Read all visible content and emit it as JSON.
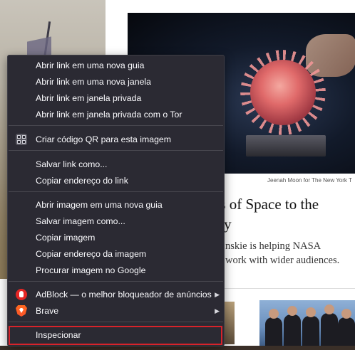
{
  "page": {
    "caption": "Jeenah Moon for The New York T",
    "headline_line1": "ths of Space to the",
    "headline_line2": "lery",
    "summary_line1": "nskie is helping NASA",
    "summary_line2": "work with wider audiences."
  },
  "context_menu": {
    "items": [
      {
        "label": "Abrir link em uma nova guia"
      },
      {
        "label": "Abrir link em uma nova janela"
      },
      {
        "label": "Abrir link em janela privada"
      },
      {
        "label": "Abrir link em janela privada com o Tor"
      },
      {
        "label": "Criar código QR para esta imagem",
        "icon": "qr-code-icon"
      },
      {
        "label": "Salvar link como..."
      },
      {
        "label": "Copiar endereço do link"
      },
      {
        "label": "Abrir imagem em uma nova guia"
      },
      {
        "label": "Salvar imagem como..."
      },
      {
        "label": "Copiar imagem"
      },
      {
        "label": "Copiar endereço da imagem"
      },
      {
        "label": "Procurar imagem no Google"
      },
      {
        "label": "AdBlock — o melhor bloqueador de anúncios",
        "icon": "adblock-icon",
        "submenu": true
      },
      {
        "label": "Brave",
        "icon": "brave-icon",
        "submenu": true
      },
      {
        "label": "Inspecionar",
        "highlighted": true
      }
    ],
    "submenu_arrow": "▶",
    "colors": {
      "background": "#2b2a33",
      "text": "#fbfbfe",
      "highlight_border": "#d8232a"
    }
  }
}
